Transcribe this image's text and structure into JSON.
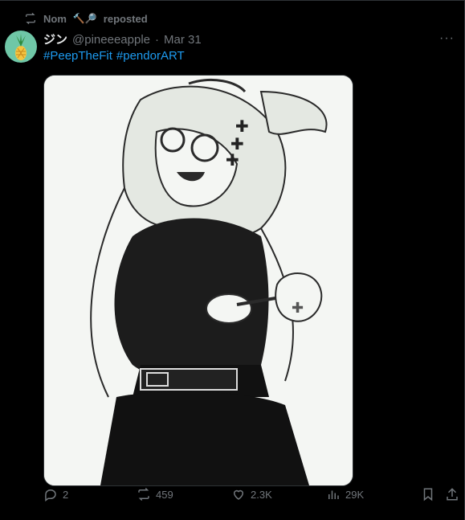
{
  "repost": {
    "user": "Nom",
    "emoji": "🔨🔎",
    "label": "reposted"
  },
  "post": {
    "display_name": "ジン",
    "handle": "@pineeeapple",
    "separator": "·",
    "date": "Mar 31",
    "hashtags": [
      "#PeepTheFit",
      "#pendorART"
    ],
    "more_label": "···"
  },
  "stats": {
    "replies": "2",
    "reposts": "459",
    "likes": "2.3K",
    "views": "29K"
  },
  "colors": {
    "accent": "#1d9bf0",
    "muted": "#71767b",
    "text": "#e7e9ea",
    "background": "#000000"
  }
}
